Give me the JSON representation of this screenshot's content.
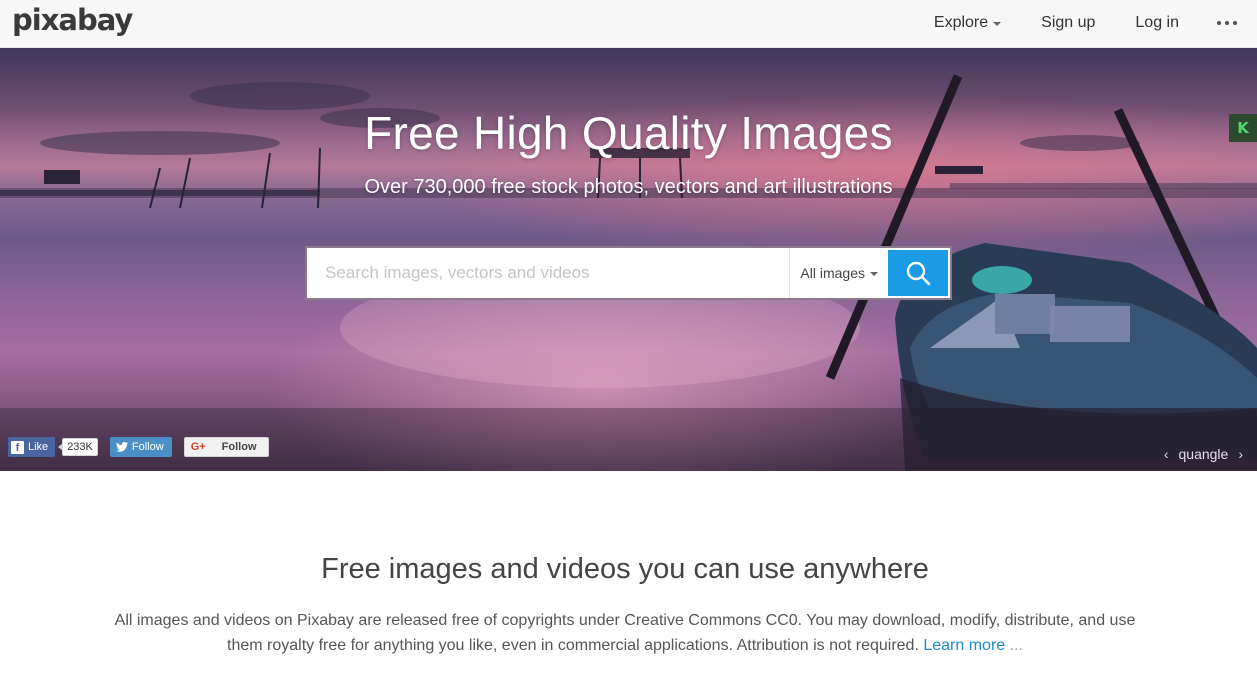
{
  "header": {
    "logo": "pixabay",
    "nav": {
      "explore": "Explore",
      "signup": "Sign up",
      "login": "Log in"
    }
  },
  "hero": {
    "title": "Free High Quality Images",
    "subtitle": "Over 730,000 free stock photos, vectors and art illustrations",
    "search": {
      "placeholder": "Search images, vectors and videos",
      "value": "",
      "type_selected": "All images"
    },
    "badge": "K",
    "social": {
      "fb_like": "Like",
      "fb_count": "233K",
      "twitter_follow": "Follow",
      "gplus_icon": "G+",
      "gplus_follow": "Follow"
    },
    "credit": {
      "prev": "‹",
      "author": "quangle",
      "next": "›"
    }
  },
  "content": {
    "title": "Free images and videos you can use anywhere",
    "text": "All images and videos on Pixabay are released free of copyrights under Creative Commons CC0. You may download, modify, distribute, and use them royalty free for anything you like, even in commercial applications. Attribution is not required.",
    "learn_more": "Learn more",
    "ellipsis": "..."
  },
  "colors": {
    "accent": "#1a9be6",
    "facebook": "#4a66a0",
    "twitter": "#4b8fc7",
    "link": "#1a8ad0"
  }
}
